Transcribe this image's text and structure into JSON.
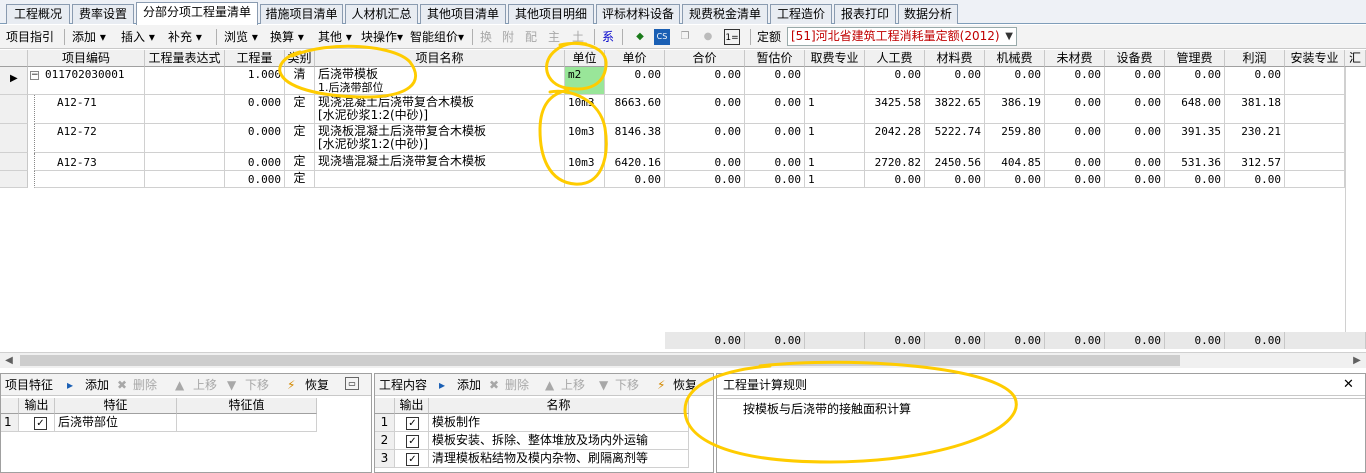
{
  "tabs": [
    "工程概况",
    "费率设置",
    "分部分项工程量清单",
    "措施项目清单",
    "人材机汇总",
    "其他项目清单",
    "其他项目明细",
    "评标材料设备",
    "规费税金清单",
    "工程造价",
    "报表打印",
    "数据分析"
  ],
  "toolbar": {
    "guide": "项目指引",
    "add": "添加",
    "insert": "插入",
    "supplement": "补充",
    "browse": "浏览",
    "convert": "换算",
    "other": "其他",
    "batch": "块操作",
    "smart": "智能组价",
    "huan": "换",
    "fu": "附",
    "pei": "配",
    "zhu": "主",
    "tu": "土",
    "xi": "系",
    "cs": "CS",
    "quota_label": "定额",
    "quota_value": "[51]河北省建筑工程消耗量定额(2012)"
  },
  "grid": {
    "headers": [
      "项目编码",
      "工程量表达式",
      "工程量",
      "类别",
      "项目名称",
      "单位",
      "单价",
      "合价",
      "暂估价",
      "取费专业",
      "人工费",
      "材料费",
      "机械费",
      "未材费",
      "设备费",
      "管理费",
      "利润",
      "安装专业",
      "汇"
    ],
    "rows": [
      {
        "code": "011702030001",
        "expr": "",
        "qty": "1.000",
        "cat": "清",
        "name1": "后浇带模板",
        "name2": "1.后浇带部位",
        "unit": "m2",
        "price": "0.00",
        "total": "0.00",
        "est": "0.00",
        "fee": "",
        "labor": "0.00",
        "mat": "0.00",
        "mach": "0.00",
        "unmat": "0.00",
        "equip": "0.00",
        "mgmt": "0.00",
        "profit": "0.00"
      },
      {
        "code": "A12-71",
        "expr": "",
        "qty": "0.000",
        "cat": "定",
        "name1": "现浇混凝土后浇带复合木模板",
        "name2": "[水泥砂浆1:2(中砂)]",
        "unit": "10m3",
        "price": "8663.60",
        "total": "0.00",
        "est": "0.00",
        "fee": "1",
        "labor": "3425.58",
        "mat": "3822.65",
        "mach": "386.19",
        "unmat": "0.00",
        "equip": "0.00",
        "mgmt": "648.00",
        "profit": "381.18"
      },
      {
        "code": "A12-72",
        "expr": "",
        "qty": "0.000",
        "cat": "定",
        "name1": "现浇板混凝土后浇带复合木模板",
        "name2": "[水泥砂浆1:2(中砂)]",
        "unit": "10m3",
        "price": "8146.38",
        "total": "0.00",
        "est": "0.00",
        "fee": "1",
        "labor": "2042.28",
        "mat": "5222.74",
        "mach": "259.80",
        "unmat": "0.00",
        "equip": "0.00",
        "mgmt": "391.35",
        "profit": "230.21"
      },
      {
        "code": "A12-73",
        "expr": "",
        "qty": "0.000",
        "cat": "定",
        "name1": "现浇墙混凝土后浇带复合木模板",
        "name2": "",
        "unit": "10m3",
        "price": "6420.16",
        "total": "0.00",
        "est": "0.00",
        "fee": "1",
        "labor": "2720.82",
        "mat": "2450.56",
        "mach": "404.85",
        "unmat": "0.00",
        "equip": "0.00",
        "mgmt": "531.36",
        "profit": "312.57"
      },
      {
        "code": "",
        "expr": "",
        "qty": "0.000",
        "cat": "定",
        "name1": "",
        "name2": "",
        "unit": "",
        "price": "0.00",
        "total": "0.00",
        "est": "0.00",
        "fee": "1",
        "labor": "0.00",
        "mat": "0.00",
        "mach": "0.00",
        "unmat": "0.00",
        "equip": "0.00",
        "mgmt": "0.00",
        "profit": "0.00"
      }
    ],
    "totals": {
      "total": "0.00",
      "est": "0.00",
      "labor": "0.00",
      "mat": "0.00",
      "mach": "0.00",
      "unmat": "0.00",
      "equip": "0.00",
      "mgmt": "0.00",
      "profit": "0.00"
    }
  },
  "feature_panel": {
    "title": "项目特征",
    "add": "添加",
    "delete": "删除",
    "up": "上移",
    "down": "下移",
    "restore": "恢复",
    "col_output": "输出",
    "col_feature": "特征",
    "col_value": "特征值",
    "rows": [
      {
        "idx": "1",
        "feature": "后浇带部位",
        "value": ""
      }
    ]
  },
  "content_panel": {
    "title": "工程内容",
    "add": "添加",
    "delete": "删除",
    "up": "上移",
    "down": "下移",
    "restore": "恢复",
    "col_output": "输出",
    "col_name": "名称",
    "rows": [
      {
        "idx": "1",
        "name": "模板制作"
      },
      {
        "idx": "2",
        "name": "模板安装、拆除、整体堆放及场内外运输"
      },
      {
        "idx": "3",
        "name": "清理模板粘结物及模内杂物、刷隔离剂等"
      }
    ]
  },
  "rule_panel": {
    "title": "工程量计算规则",
    "text": "按模板与后浇带的接触面积计算"
  },
  "colors": {
    "accent": "#0066cc",
    "highlight_cell": "#99e699",
    "annotation": "#ffcc00",
    "quota_text": "#c00000"
  }
}
